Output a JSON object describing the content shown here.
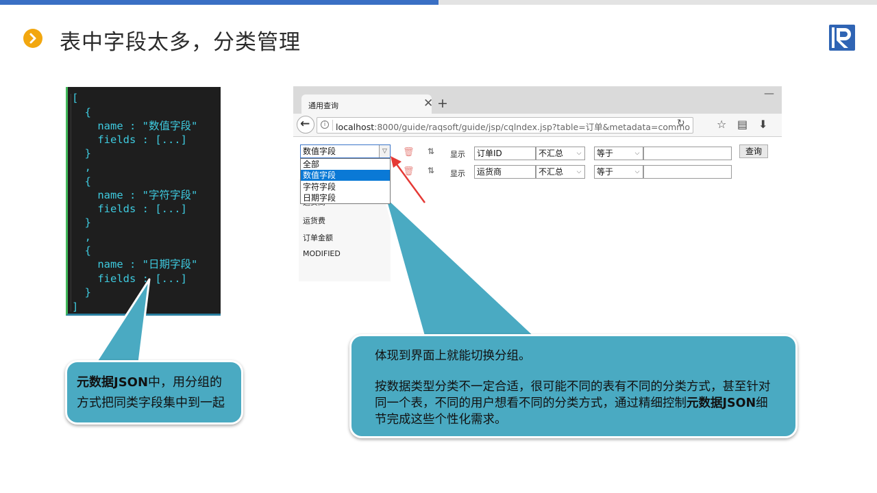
{
  "slide": {
    "title": "表中字段太多，分类管理"
  },
  "code": {
    "lines": [
      "[",
      "  {",
      "    name : \"数值字段\"",
      "    fields : [...]",
      "  }",
      "  ,",
      "  {",
      "    name : \"字符字段\"",
      "    fields : [...]",
      "  }",
      "  ,",
      "  {",
      "    name : \"日期字段\"",
      "    fields : [...]",
      "  }",
      "]"
    ]
  },
  "callout_left": {
    "bold": "元数据JSON",
    "text": "中，用分组的方式把同类字段集中到一起"
  },
  "callout_right": {
    "line1": "体现到界面上就能切换分组。",
    "line2_text": "按数据类型分类不一定合适，很可能不同的表有不同的分类方式，甚至针对同一个表，不同的用户想看不同的分类方式，通过精细控制",
    "line2_bold": "元数据JSON",
    "line2_tail": "细节完成这些个性化需求。"
  },
  "browser": {
    "tab_title": "通用查询",
    "url_host": "localhost",
    "url_rest": ":8000/guide/raqsoft/guide/jsp/cqlndex.jsp?table=订单&metadata=commo",
    "category_selected": "数值字段",
    "dropdown_options": [
      "全部",
      "数值字段",
      "字符字段",
      "日期字段"
    ],
    "field_list": [
      "运货费",
      "订单金额",
      "MODIFIED"
    ],
    "field_list_partial": "运货商",
    "rows": [
      {
        "show_label": "显示",
        "field": "订单ID",
        "agg": "不汇总",
        "op": "等于",
        "value": ""
      },
      {
        "show_label": "显示",
        "field": "运货商",
        "agg": "不汇总",
        "op": "等于",
        "value": ""
      }
    ],
    "query_button": "查询"
  },
  "colors": {
    "accent_blue": "#3a6fc4",
    "bullet_orange": "#f2a70f",
    "callout_teal": "#4aaac2",
    "code_text": "#3ecbe0",
    "arrow_red": "#e53935"
  }
}
